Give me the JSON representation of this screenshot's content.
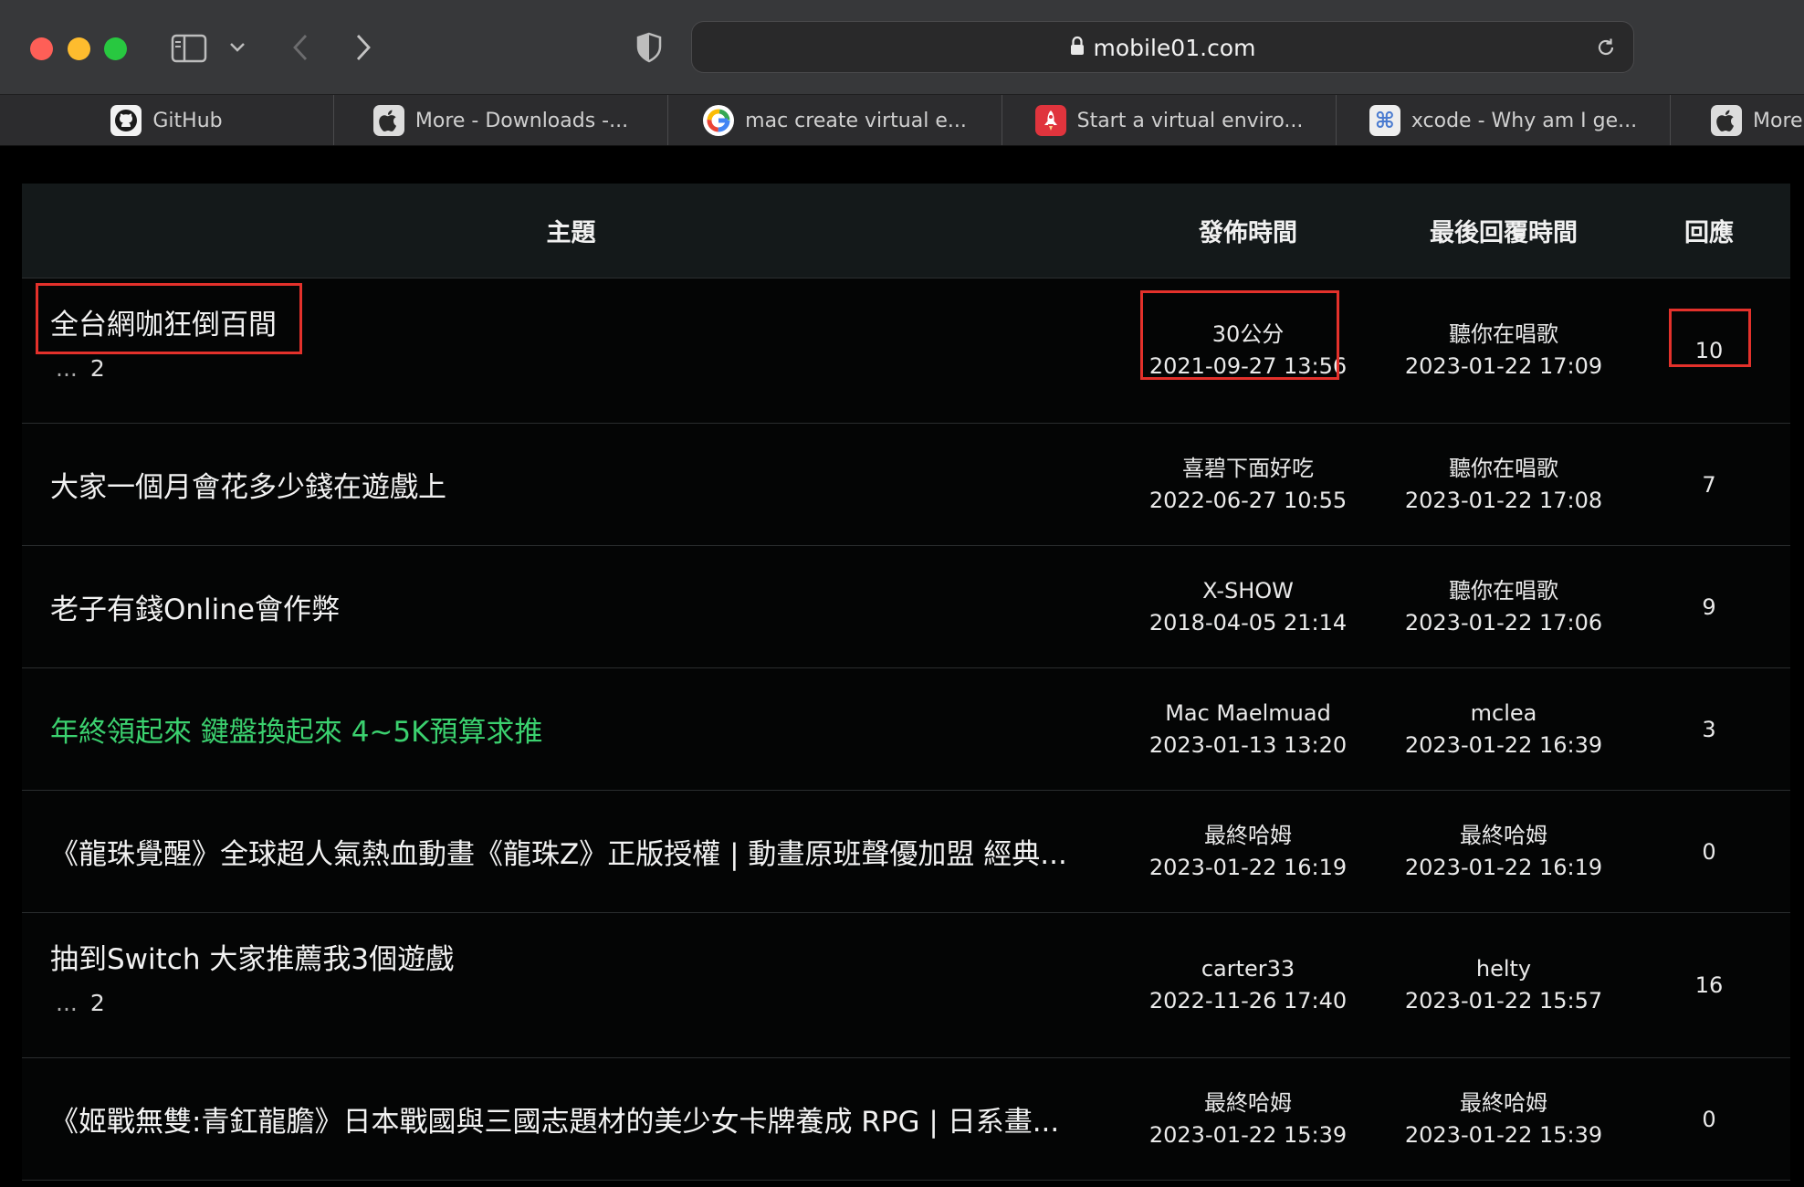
{
  "browser": {
    "url": "mobile01.com",
    "favorites": [
      {
        "label": "GitHub",
        "icon": "github-icon"
      },
      {
        "label": "More - Downloads -...",
        "icon": "apple-icon"
      },
      {
        "label": "mac create virtual e...",
        "icon": "google-icon"
      },
      {
        "label": "Start a virtual enviro...",
        "icon": "rocket-icon"
      },
      {
        "label": "xcode - Why am I ge...",
        "icon": "command-icon"
      },
      {
        "label": "More -",
        "icon": "apple-icon"
      }
    ]
  },
  "table": {
    "headers": {
      "topic": "主題",
      "published": "發佈時間",
      "last_reply": "最後回覆時間",
      "replies": "回應"
    },
    "rows": [
      {
        "title": "全台網咖狂倒百間",
        "pager_dots": "...",
        "pager_page": "2",
        "author": "30公分",
        "published": "2021-09-27 13:56",
        "last_user": "聽你在唱歌",
        "last_time": "2023-01-22 17:09",
        "replies": "10"
      },
      {
        "title": "大家一個月會花多少錢在遊戲上",
        "author": "喜碧下面好吃",
        "published": "2022-06-27 10:55",
        "last_user": "聽你在唱歌",
        "last_time": "2023-01-22 17:08",
        "replies": "7"
      },
      {
        "title": "老子有錢Online會作弊",
        "author": "X-SHOW",
        "published": "2018-04-05 21:14",
        "last_user": "聽你在唱歌",
        "last_time": "2023-01-22 17:06",
        "replies": "9"
      },
      {
        "title": "年終領起來 鍵盤換起來 4~5K預算求推",
        "title_color": "#3bd16f",
        "author": "Mac Maelmuad",
        "published": "2023-01-13 13:20",
        "last_user": "mclea",
        "last_time": "2023-01-22 16:39",
        "replies": "3"
      },
      {
        "title": "《龍珠覺醒》全球超人氣熱血動畫《龍珠Z》正版授權 | 動畫原班聲優加盟 經典...",
        "author": "最終哈姆",
        "published": "2023-01-22 16:19",
        "last_user": "最終哈姆",
        "last_time": "2023-01-22 16:19",
        "replies": "0"
      },
      {
        "title": "抽到Switch 大家推薦我3個遊戲",
        "pager_dots": "...",
        "pager_page": "2",
        "author": "carter33",
        "published": "2022-11-26 17:40",
        "last_user": "helty",
        "last_time": "2023-01-22 15:57",
        "replies": "16"
      },
      {
        "title": "《姬戰無雙:青釭龍膽》日本戰國與三國志題材的美少女卡牌養成 RPG | 日系畫...",
        "author": "最終哈姆",
        "published": "2023-01-22 15:39",
        "last_user": "最終哈姆",
        "last_time": "2023-01-22 15:39",
        "replies": "0"
      }
    ]
  },
  "colors": {
    "highlight": "#e3312b",
    "green_title": "#3bd16f"
  }
}
